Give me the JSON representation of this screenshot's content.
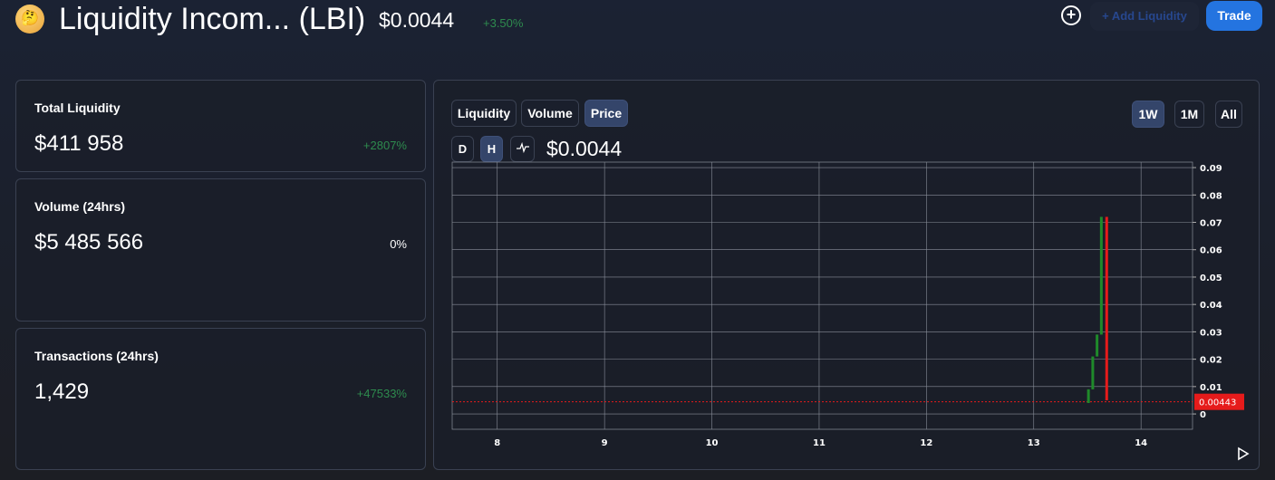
{
  "header": {
    "emoji": "🤔",
    "title": "Liquidity Incom... (LBI)",
    "price": "$0.0044",
    "change": "+3.50%",
    "add_liquidity": "+ Add Liquidity",
    "trade": "Trade"
  },
  "stats": [
    {
      "label": "Total Liquidity",
      "value": "$411 958",
      "change": "+2807%",
      "change_color": "#2e8b4e"
    },
    {
      "label": "Volume (24hrs)",
      "value": "$5 485 566",
      "change": "0%",
      "change_color": "#ffffff"
    },
    {
      "label": "Transactions (24hrs)",
      "value": "1,429",
      "change": "+47533%",
      "change_color": "#2e8b4e"
    }
  ],
  "chart_panel": {
    "tabs": [
      "Liquidity",
      "Volume",
      "Price"
    ],
    "active_tab": "Price",
    "intervals": [
      "D",
      "H"
    ],
    "active_interval": "H",
    "current_price": "$0.0044",
    "ranges": [
      "1W",
      "1M",
      "All"
    ],
    "active_range": "1W"
  },
  "chart_data": {
    "type": "candlestick",
    "x_ticks": [
      "8",
      "9",
      "10",
      "11",
      "12",
      "13",
      "14"
    ],
    "xlim": [
      7.58,
      14.48
    ],
    "y_ticks": [
      "0",
      "0.01",
      "0.02",
      "0.03",
      "0.04",
      "0.05",
      "0.06",
      "0.07",
      "0.08",
      "0.09"
    ],
    "ylim": [
      -0.0056,
      0.092
    ],
    "candles": [
      {
        "t": 13.51,
        "o": 0.004,
        "h": 0.009,
        "l": 0.004,
        "c": 0.009
      },
      {
        "t": 13.55,
        "o": 0.009,
        "h": 0.021,
        "l": 0.009,
        "c": 0.021
      },
      {
        "t": 13.59,
        "o": 0.021,
        "h": 0.029,
        "l": 0.021,
        "c": 0.029
      },
      {
        "t": 13.63,
        "o": 0.029,
        "h": 0.072,
        "l": 0.029,
        "c": 0.072
      },
      {
        "t": 13.68,
        "o": 0.072,
        "h": 0.072,
        "l": 0.005,
        "c": 0.005
      }
    ],
    "last_price": 0.00443,
    "last_price_label": "0.00443",
    "up_color": "#1f8a2a",
    "down_color": "#e61b1b"
  }
}
